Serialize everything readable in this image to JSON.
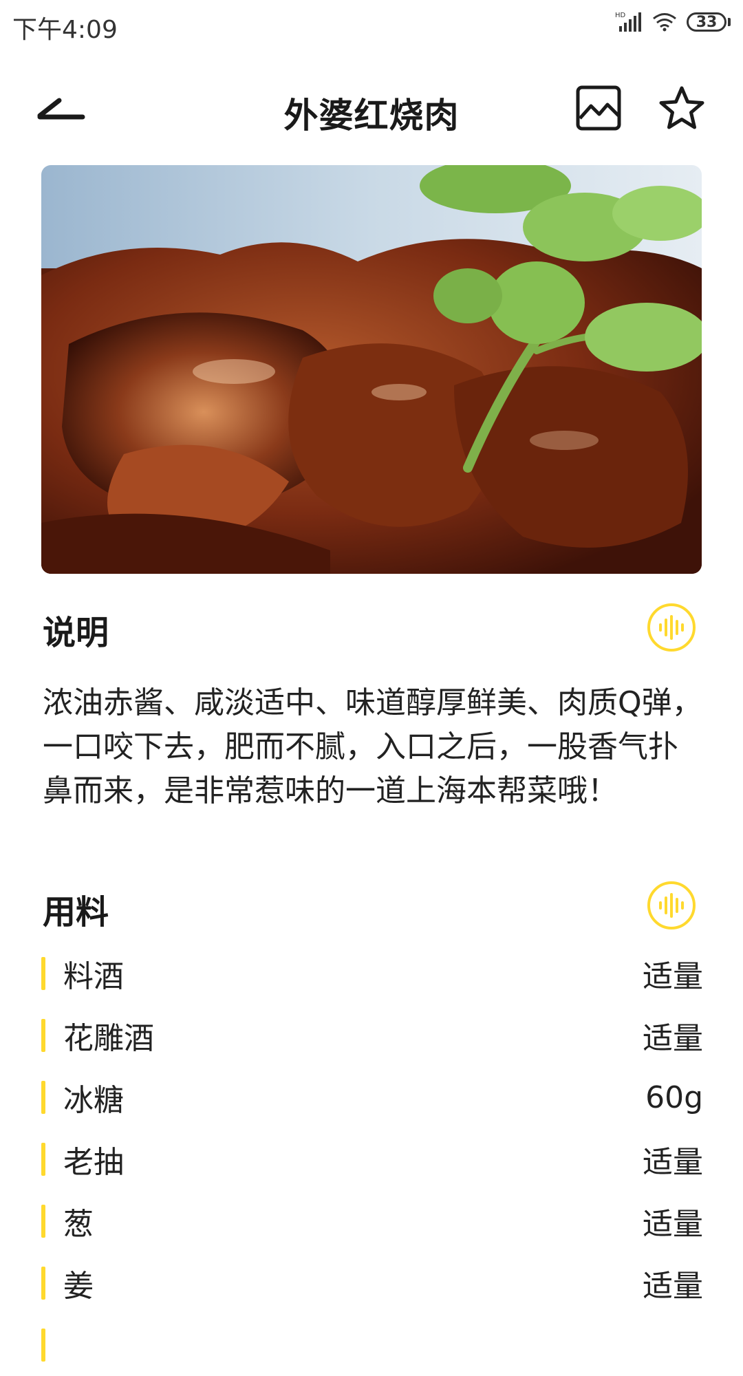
{
  "status_bar": {
    "time": "下午4:09",
    "battery": "33",
    "network": "HD"
  },
  "header": {
    "title": "外婆红烧肉"
  },
  "sections": {
    "description_title": "说明",
    "description_text": "浓油赤酱、咸淡适中、味道醇厚鲜美、肉质Q弹，一口咬下去，肥而不腻，入口之后，一股香气扑鼻而来，是非常惹味的一道上海本帮菜哦！",
    "ingredients_title": "用料"
  },
  "ingredients": [
    {
      "name": "料酒",
      "amount": "适量"
    },
    {
      "name": "花雕酒",
      "amount": "适量"
    },
    {
      "name": "冰糖",
      "amount": "60g"
    },
    {
      "name": "老抽",
      "amount": "适量"
    },
    {
      "name": "葱",
      "amount": "适量"
    },
    {
      "name": "姜",
      "amount": "适量"
    }
  ],
  "colors": {
    "accent": "#ffd92e",
    "text": "#1a1a1a"
  }
}
